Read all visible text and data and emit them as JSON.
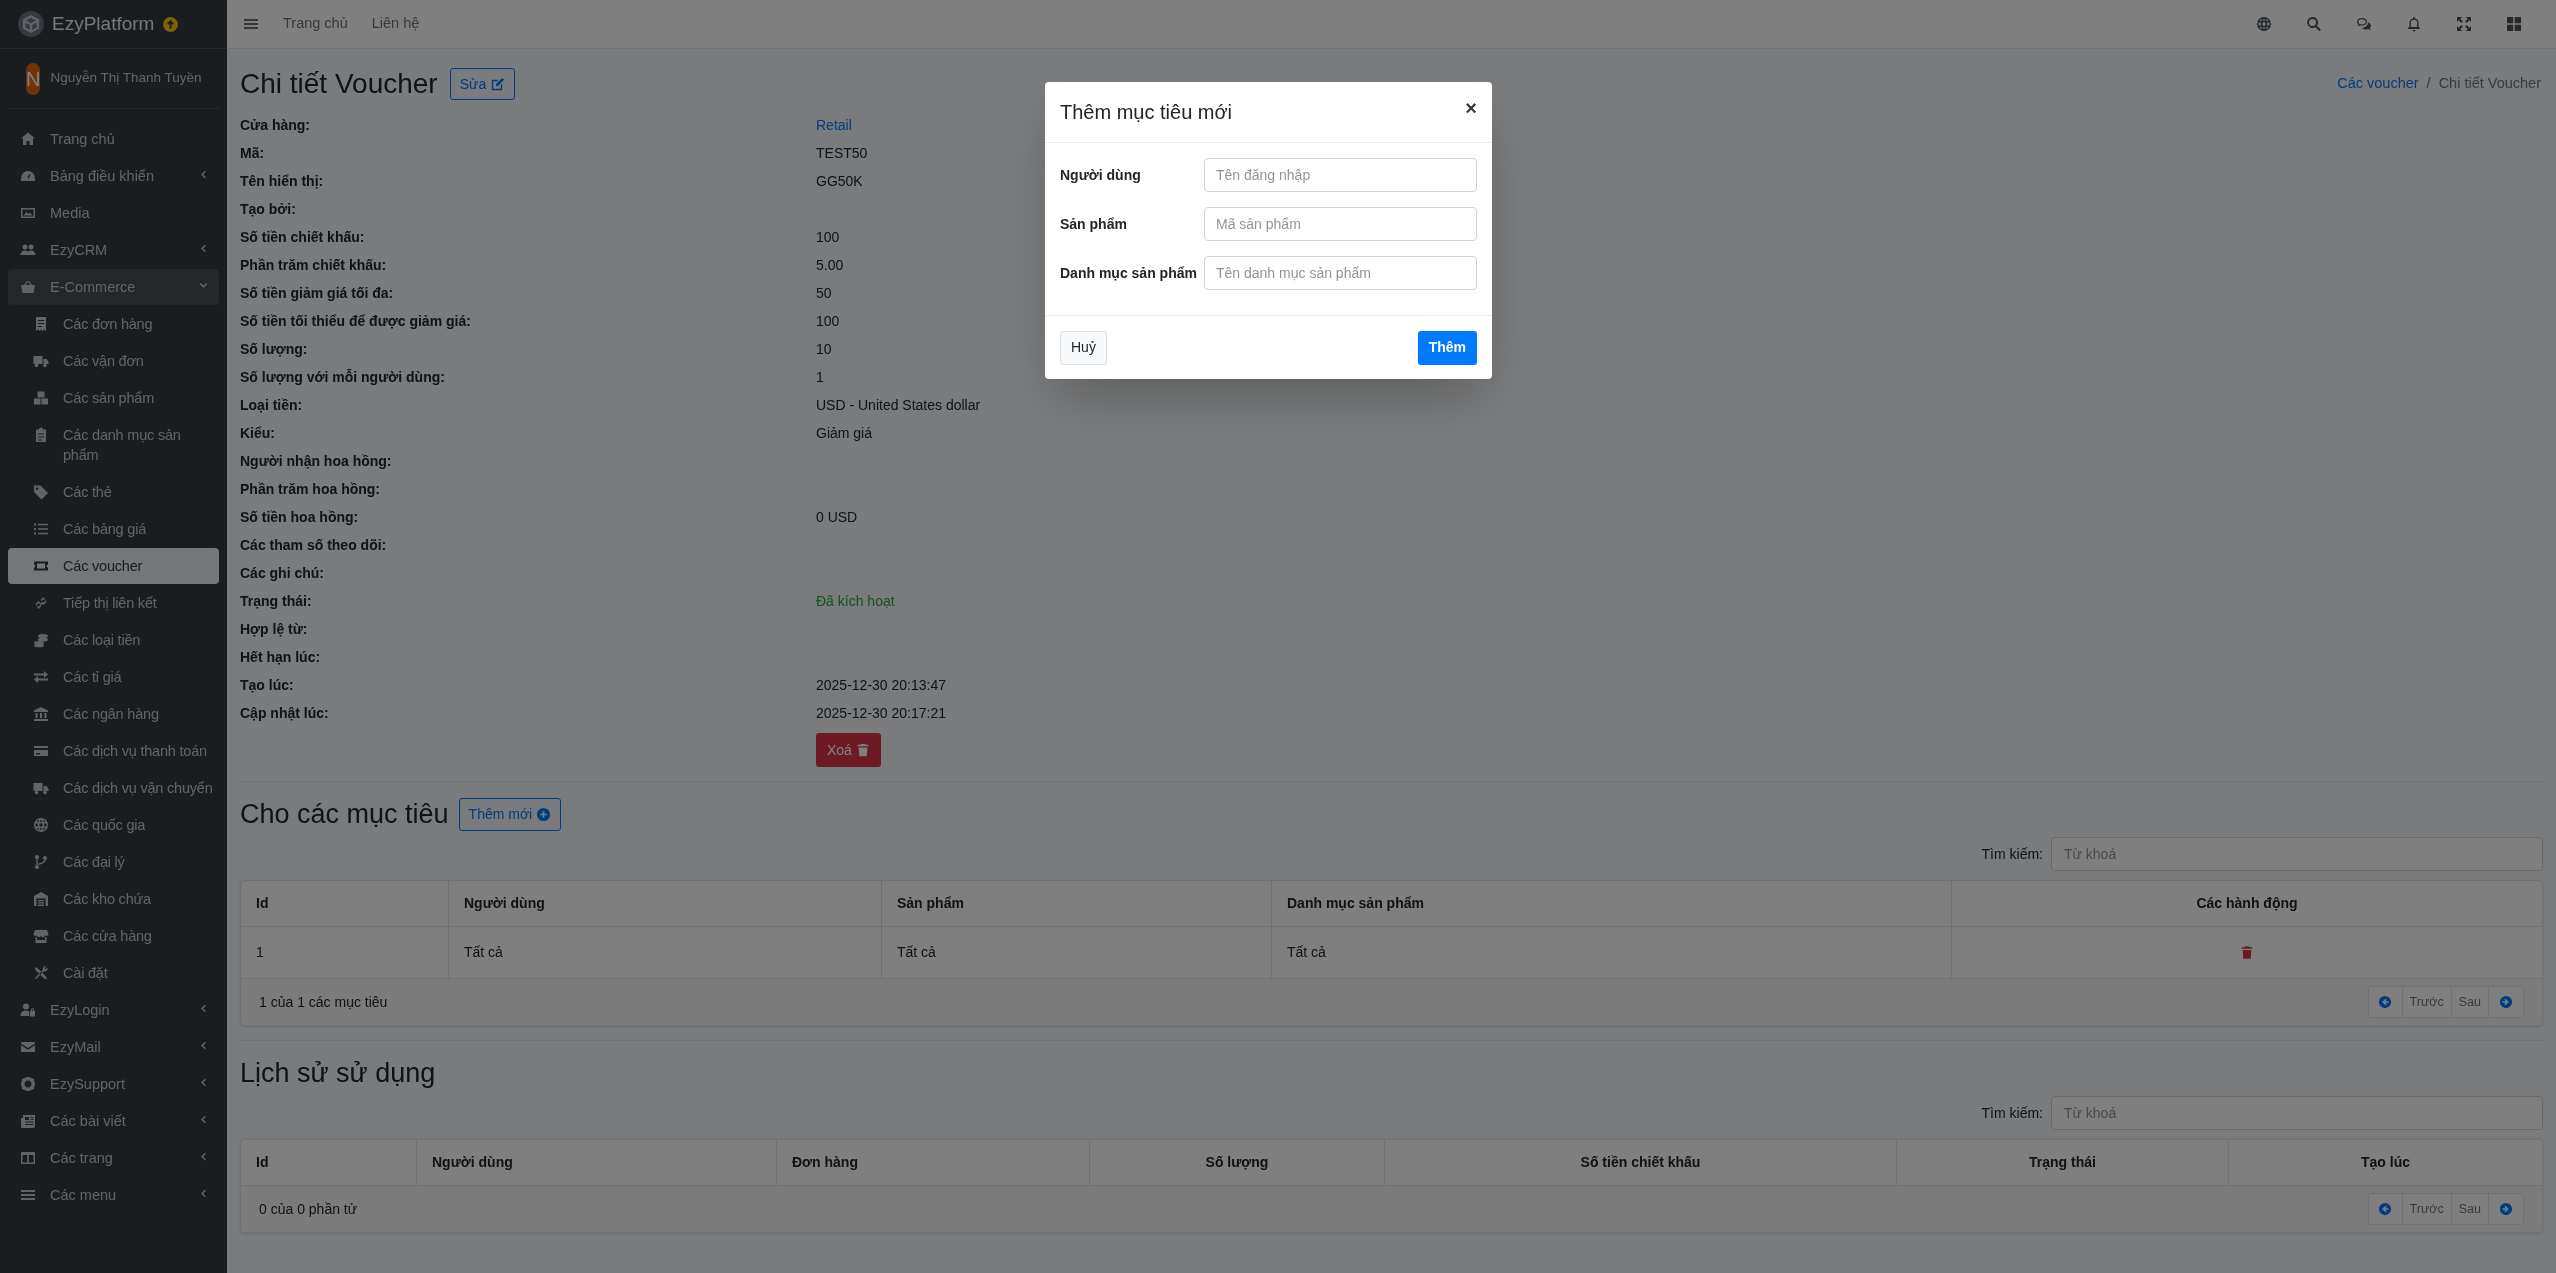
{
  "topbar": {
    "nav": [
      "Trang chủ",
      "Liên hệ"
    ]
  },
  "sidebar": {
    "brand": "EzyPlatform",
    "user": {
      "initial": "N",
      "name": "Nguyễn Thị Thanh Tuyền"
    },
    "items": [
      {
        "label": "Trang chủ",
        "selected": false
      },
      {
        "label": "Bảng điều khiển",
        "selected": false,
        "expanded": false
      },
      {
        "label": "Media",
        "selected": false
      },
      {
        "label": "EzyCRM",
        "selected": false,
        "expanded": false
      },
      {
        "label": "E-Commerce",
        "selected": false,
        "expanded": true,
        "children": [
          {
            "label": "Các đơn hàng",
            "selected": false
          },
          {
            "label": "Các vận đơn",
            "selected": false
          },
          {
            "label": "Các sản phẩm",
            "selected": false
          },
          {
            "label": "Các danh mục sản phẩm",
            "selected": false
          },
          {
            "label": "Các thẻ",
            "selected": false
          },
          {
            "label": "Các bảng giá",
            "selected": false
          },
          {
            "label": "Các voucher",
            "selected": true
          },
          {
            "label": "Tiếp thị liên kết",
            "selected": false
          },
          {
            "label": "Các loại tiền",
            "selected": false
          },
          {
            "label": "Các tỉ giá",
            "selected": false
          },
          {
            "label": "Các ngân hàng",
            "selected": false
          },
          {
            "label": "Các dịch vụ thanh toán",
            "selected": false
          },
          {
            "label": "Các dịch vụ vận chuyển",
            "selected": false
          },
          {
            "label": "Các quốc gia",
            "selected": false
          },
          {
            "label": "Các đại lý",
            "selected": false
          },
          {
            "label": "Các kho chứa",
            "selected": false
          },
          {
            "label": "Các cửa hàng",
            "selected": false
          },
          {
            "label": "Cài đặt",
            "selected": false
          }
        ]
      },
      {
        "label": "EzyLogin",
        "selected": false,
        "expanded": false
      },
      {
        "label": "EzyMail",
        "selected": false,
        "expanded": false
      },
      {
        "label": "EzySupport",
        "selected": false,
        "expanded": false
      },
      {
        "label": "Các bài viết",
        "selected": false,
        "expanded": false
      },
      {
        "label": "Các trang",
        "selected": false,
        "expanded": false
      },
      {
        "label": "Các menu",
        "selected": false,
        "expanded": false
      }
    ]
  },
  "page": {
    "title": "Chi tiết Voucher",
    "edit_button": "Sửa",
    "breadcrumb": [
      "Các voucher",
      "Chi tiết Voucher"
    ],
    "breadcrumb_separator": "/",
    "fields": [
      {
        "label": "Cửa hàng:",
        "value": "Retail",
        "kind": "link"
      },
      {
        "label": "Mã:",
        "value": "TEST50",
        "kind": "text"
      },
      {
        "label": "Tên hiển thị:",
        "value": "GG50K",
        "kind": "text"
      },
      {
        "label": "Tạo bởi:"
      },
      {
        "label": "Số tiền chiết khấu:",
        "value": "100",
        "kind": "text"
      },
      {
        "label": "Phần trăm chiết khấu:",
        "value": "5.00",
        "kind": "text"
      },
      {
        "label": "Số tiền giảm giá tối đa:",
        "value": "50",
        "kind": "text"
      },
      {
        "label": "Số tiền tối thiểu để được giảm giá:",
        "value": "100",
        "kind": "text"
      },
      {
        "label": "Số lượng:",
        "value": "10",
        "kind": "text"
      },
      {
        "label": "Số lượng với mỗi người dùng:",
        "value": "1",
        "kind": "text"
      },
      {
        "label": "Loại tiền:",
        "value": "USD - United States dollar",
        "kind": "text"
      },
      {
        "label": "Kiểu:",
        "value": "Giảm giá",
        "kind": "text"
      },
      {
        "label": "Người nhận hoa hồng:"
      },
      {
        "label": "Phần trăm hoa hồng:"
      },
      {
        "label": "Số tiền hoa hồng:",
        "value": "0 USD",
        "kind": "text"
      },
      {
        "label": "Các tham số theo dõi:"
      },
      {
        "label": "Các ghi chú:"
      },
      {
        "label": "Trạng thái:",
        "value": "Đã kích hoạt",
        "kind": "status"
      },
      {
        "label": "Hợp lệ từ:"
      },
      {
        "label": "Hết hạn lúc:"
      },
      {
        "label": "Tạo lúc:",
        "value": "2025-12-30 20:13:47",
        "kind": "text"
      },
      {
        "label": "Cập nhật lúc:",
        "value": "2025-12-30 20:17:21",
        "kind": "text"
      }
    ],
    "delete_button": "Xoá"
  },
  "targets": {
    "title": "Cho các mục tiêu",
    "add_button": "Thêm mới",
    "search_label": "Tìm kiếm:",
    "search_placeholder": "Từ khoá",
    "columns": [
      "Id",
      "Người dùng",
      "Sản phẩm",
      "Danh mục sản phẩm",
      "Các hành động"
    ],
    "rows": [
      [
        "1",
        "Tất cả",
        "Tất cả",
        "Tất cả"
      ]
    ],
    "summary": "1 của 1 các mục tiêu",
    "pager": [
      "Trước",
      "Sau"
    ]
  },
  "history": {
    "title": "Lịch sử sử dụng",
    "search_label": "Tìm kiếm:",
    "search_placeholder": "Từ khoá",
    "columns": [
      "Id",
      "Người dùng",
      "Đơn hàng",
      "Số lượng",
      "Số tiền chiết khấu",
      "Trạng thái",
      "Tạo lúc"
    ],
    "summary": "0 của 0 phần tử",
    "pager": [
      "Trước",
      "Sau"
    ]
  },
  "modal": {
    "title": "Thêm mục tiêu mới",
    "close": "×",
    "fields": [
      {
        "label": "Người dùng",
        "placeholder": "Tên đăng nhập"
      },
      {
        "label": "Sản phẩm",
        "placeholder": "Mã sản phẩm"
      },
      {
        "label": "Danh mục sản phẩm",
        "placeholder": "Tên danh mục sản phẩm"
      }
    ],
    "cancel": "Huỷ",
    "submit": "Thêm"
  }
}
